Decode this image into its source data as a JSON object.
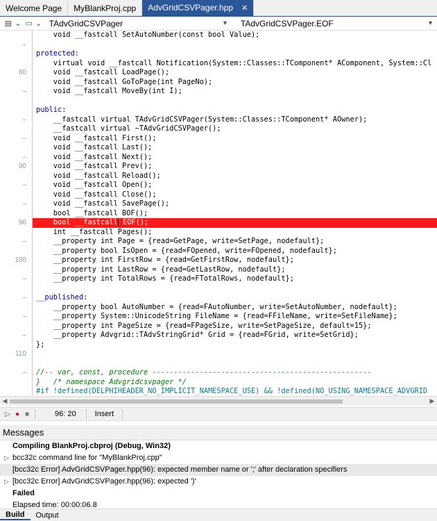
{
  "tabs": [
    {
      "label": "Welcome Page",
      "active": false
    },
    {
      "label": "MyBlankProj.cpp",
      "active": false
    },
    {
      "label": "AdvGridCSVPager.hpp",
      "active": true
    }
  ],
  "toolbar": {
    "class_combo": "TAdvGridCSVPager",
    "member_combo": "TAdvGridCSVPager.EOF"
  },
  "editor": {
    "line_numbers": {
      "n80": "80",
      "n90": "90",
      "n96": "96",
      "n100": "100",
      "n110": "110"
    },
    "lines": {
      "l0": "    void __fastcall SetAutoNumber(const bool Value);",
      "l2": "protected:",
      "l3": "    virtual void __fastcall Notification(System::Classes::TComponent* AComponent, System::Cl",
      "l4": "    void __fastcall LoadPage();",
      "l5": "    void __fastcall GoToPage(int PageNo);",
      "l6": "    void __fastcall MoveBy(int I);",
      "l8": "public:",
      "l9": "    __fastcall virtual TAdvGridCSVPager(System::Classes::TComponent* AOwner);",
      "l10": "    __fastcall virtual ~TAdvGridCSVPager();",
      "l11": "    void __fastcall First();",
      "l12": "    void __fastcall Last();",
      "l13": "    void __fastcall Next();",
      "l14": "    void __fastcall Prev();",
      "l15": "    void __fastcall Reload();",
      "l16": "    void __fastcall Open();",
      "l17": "    void __fastcall Close();",
      "l18": "    void __fastcall SavePage();",
      "l19": "    bool __fastcall BOF();",
      "l20a": "    bool __fastcall",
      "l20b": " EOF();",
      "l21": "    int __fastcall Pages();",
      "l22": "    __property int Page = {read=GetPage, write=SetPage, nodefault};",
      "l23": "    __property bool IsOpen = {read=FOpened, write=FOpened, nodefault};",
      "l24": "    __property int FirstRow = {read=GetFirstRow, nodefault};",
      "l25": "    __property int LastRow = {read=GetLastRow, nodefault};",
      "l26": "    __property int TotalRows = {read=FTotalRows, nodefault};",
      "l28": "__published:",
      "l29": "    __property bool AutoNumber = {read=FAutoNumber, write=SetAutoNumber, nodefault};",
      "l30": "    __property System::UnicodeString FileName = {read=FFileName, write=SetFileName};",
      "l31": "    __property int PageSize = {read=FPageSize, write=SetPageSize, default=15};",
      "l32": "    __property Advgrid::TAdvStringGrid* Grid = {read=FGrid, write=SetGrid};",
      "l33": "};",
      "l36": "//-- var, const, procedure ---------------------------------------------------",
      "l37": "}   /* namespace Advgridcsvpager */",
      "l38": "#if !defined(DELPHIHEADER_NO_IMPLICIT_NAMESPACE_USE) && !defined(NO_USING_NAMESPACE_ADVGRID"
    }
  },
  "status": {
    "position": "96: 20",
    "mode": "Insert"
  },
  "messages": {
    "title": "Messages",
    "items": [
      "Compiling BlankProj.cbproj (Debug, Win32)",
      "bcc32c command line for \"MyBlankProj.cpp\"",
      "[bcc32c Error] AdvGridCSVPager.hpp(96): expected member name or ';' after declaration specifiers",
      "[bcc32c Error] AdvGridCSVPager.hpp(96): expected ')'",
      "Failed",
      "Elapsed time: 00:00:06.8"
    ],
    "tabs": [
      "Build",
      "Output"
    ]
  }
}
